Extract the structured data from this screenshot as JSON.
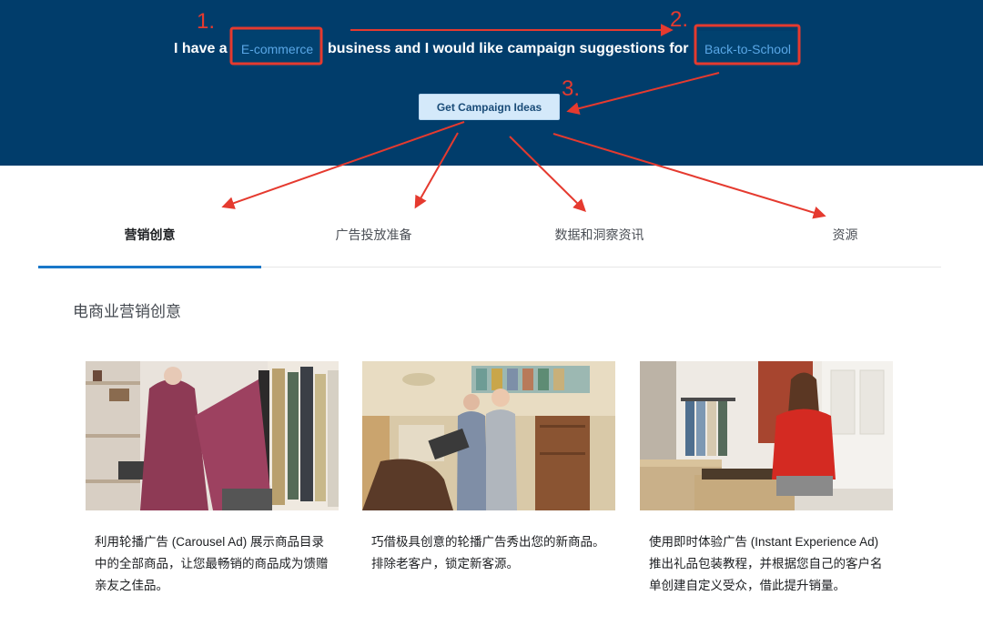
{
  "hero": {
    "prefix": "I have a",
    "business_select": "E-commerce",
    "middle": "business and I would like campaign suggestions for",
    "occasion_select": "Back-to-School",
    "cta_label": "Get Campaign Ideas"
  },
  "tabs": [
    {
      "label": "营销创意",
      "active": true
    },
    {
      "label": "广告投放准备",
      "active": false
    },
    {
      "label": "数据和洞察资讯",
      "active": false
    },
    {
      "label": "资源",
      "active": false
    }
  ],
  "section_title": "电商业营销创意",
  "cards": [
    {
      "image": "clothing-store-photo",
      "text": "利用轮播广告 (Carousel Ad) 展示商品目录中的全部商品，让您最畅销的商品成为馈赠亲友之佳品。"
    },
    {
      "image": "home-decor-shop-photo",
      "text": "巧借极具创意的轮播广告秀出您的新商品。排除老客户，锁定新客源。"
    },
    {
      "image": "packing-gift-box-photo",
      "text": "使用即时体验广告 (Instant Experience Ad) 推出礼品包装教程，并根据您自己的客户名单创建自定义受众，借此提升销量。"
    }
  ],
  "annotations": {
    "labels": [
      "1.",
      "2.",
      "3."
    ],
    "color": "#e53a2f"
  },
  "colors": {
    "hero_bg": "#013d6b",
    "select_text": "#5aa7e6",
    "tab_indicator": "#1877c9"
  }
}
